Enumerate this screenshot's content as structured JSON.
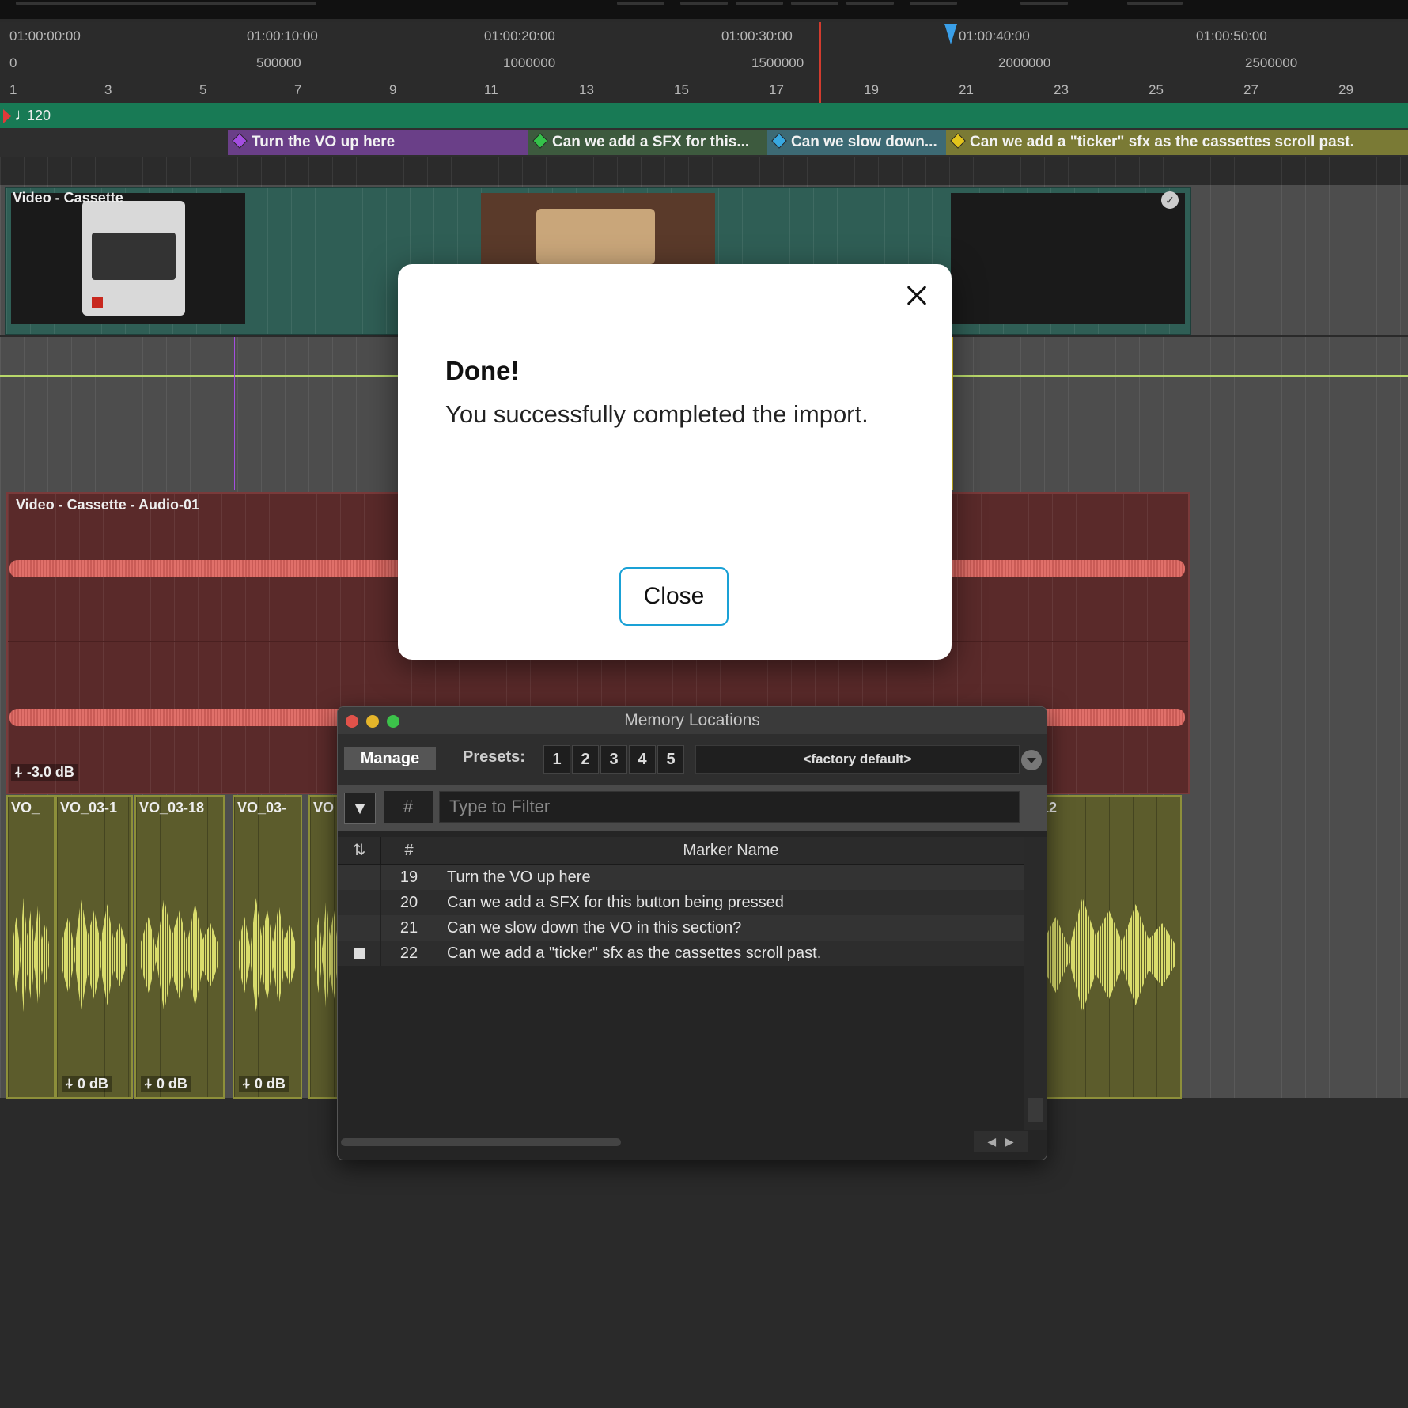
{
  "timeline": {
    "timecode": [
      "01:00:00:00",
      "01:00:10:00",
      "01:00:20:00",
      "01:00:30:00",
      "01:00:40:00",
      "01:00:50:00"
    ],
    "samples": [
      "0",
      "500000",
      "1000000",
      "1500000",
      "2000000",
      "2500000"
    ],
    "bars": [
      "1",
      "3",
      "5",
      "7",
      "9",
      "11",
      "13",
      "15",
      "17",
      "19",
      "21",
      "23",
      "25",
      "27",
      "29"
    ],
    "tempo": "120"
  },
  "markers": [
    {
      "label": "Turn the VO up here",
      "color": "#6a3f88",
      "diamond": "#a44ee0"
    },
    {
      "label": "Can we add a SFX for this...",
      "color": "#3d5a3e",
      "diamond": "#34c24a"
    },
    {
      "label": "Can we slow down...",
      "color": "#3d6a74",
      "diamond": "#38a8e0"
    },
    {
      "label": "Can we add a \"ticker\" sfx as the cassettes scroll past.",
      "color": "#7a7a35",
      "diamond": "#e2c41c"
    }
  ],
  "tracks": {
    "video_clip_name": "Video - Cassette",
    "audio_clip_name": "Video - Cassette - Audio-01",
    "audio_gain": "-3.0 dB",
    "vo_clips": [
      {
        "name": "VO_",
        "gain": ""
      },
      {
        "name": "VO_03-1",
        "gain": "0 dB"
      },
      {
        "name": "VO_03-18",
        "gain": "0 dB"
      },
      {
        "name": "VO_03-",
        "gain": "0 dB"
      },
      {
        "name": "VO",
        "gain": ""
      },
      {
        "name": "12",
        "gain": ""
      }
    ]
  },
  "dialog": {
    "title": "Done!",
    "message": "You successfully completed the import.",
    "close_label": "Close"
  },
  "memory_locations": {
    "title": "Memory Locations",
    "manage_label": "Manage",
    "presets_label": "Presets:",
    "presets": [
      "1",
      "2",
      "3",
      "4",
      "5"
    ],
    "factory_default": "<factory default>",
    "filter_hash": "#",
    "filter_placeholder": "Type to Filter",
    "columns": {
      "num": "#",
      "name": "Marker Name"
    },
    "rows": [
      {
        "num": "19",
        "name": "Turn the VO up here",
        "flag": false
      },
      {
        "num": "20",
        "name": "Can we add a SFX for this button being pressed",
        "flag": false
      },
      {
        "num": "21",
        "name": "Can we slow down the VO in this section?",
        "flag": false
      },
      {
        "num": "22",
        "name": "Can we add a \"ticker\" sfx as the cassettes scroll past.",
        "flag": true
      }
    ]
  }
}
